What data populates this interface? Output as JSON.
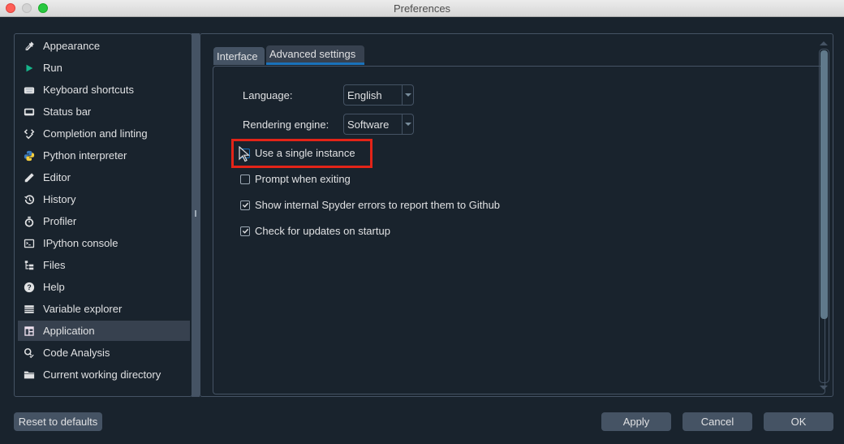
{
  "window": {
    "title": "Preferences"
  },
  "sidebar": {
    "items": [
      {
        "label": "Appearance",
        "icon": "eyedropper-icon"
      },
      {
        "label": "Run",
        "icon": "play-icon"
      },
      {
        "label": "Keyboard shortcuts",
        "icon": "keyboard-icon"
      },
      {
        "label": "Status bar",
        "icon": "status-bar-icon"
      },
      {
        "label": "Completion and linting",
        "icon": "code-check-icon"
      },
      {
        "label": "Python interpreter",
        "icon": "python-icon"
      },
      {
        "label": "Editor",
        "icon": "pencil-icon"
      },
      {
        "label": "History",
        "icon": "history-icon"
      },
      {
        "label": "Profiler",
        "icon": "stopwatch-icon"
      },
      {
        "label": "IPython console",
        "icon": "terminal-icon"
      },
      {
        "label": "Files",
        "icon": "file-tree-icon"
      },
      {
        "label": "Help",
        "icon": "help-icon"
      },
      {
        "label": "Variable explorer",
        "icon": "table-icon"
      },
      {
        "label": "Application",
        "icon": "application-layout-icon",
        "selected": true
      },
      {
        "label": "Code Analysis",
        "icon": "code-analysis-icon"
      },
      {
        "label": "Current working directory",
        "icon": "folder-icon"
      }
    ],
    "selected": "Application"
  },
  "tabs": [
    {
      "label": "Interface",
      "active": false
    },
    {
      "label": "Advanced settings",
      "active": true
    }
  ],
  "advanced": {
    "language_label": "Language:",
    "language_value": "English",
    "rendering_label": "Rendering engine:",
    "rendering_value": "Software",
    "options": [
      {
        "label": "Use a single instance",
        "checked": false,
        "highlighted": true
      },
      {
        "label": "Prompt when exiting",
        "checked": false
      },
      {
        "label": "Show internal Spyder errors to report them to Github",
        "checked": true
      },
      {
        "label": "Check for updates on startup",
        "checked": true
      }
    ]
  },
  "footer": {
    "reset_label": "Reset to defaults",
    "apply_label": "Apply",
    "cancel_label": "Cancel",
    "ok_label": "OK"
  },
  "colors": {
    "background": "#19232d",
    "border": "#455364",
    "accent": "#1a72bb",
    "highlight": "#e32418",
    "text": "#e0e1e3",
    "scrollbar_thumb": "#60798b"
  }
}
